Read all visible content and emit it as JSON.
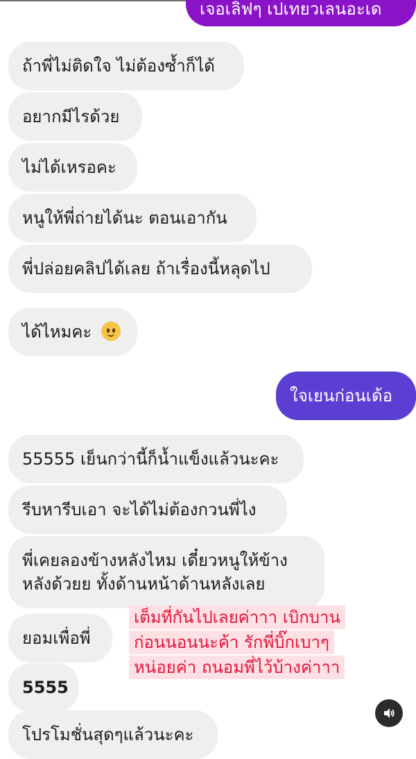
{
  "top_message": "เจอเลิฟๆ เปเทยวเลนอะเด",
  "messages": [
    {
      "text": "ถ้าพี่ไม่ติดใจ ไม่ต้องซ้ำก็ได้"
    },
    {
      "text": "อยากมีไรด้วย"
    },
    {
      "text": "ไม่ได้เหรอคะ"
    },
    {
      "text": "หนูให้พี่ถ่ายได้นะ ตอนเอากัน"
    },
    {
      "text": "พี่ปล่อยคลิปได้เลย ถ้าเรื่องนี้หลุดไป"
    },
    {
      "text": "ได้ไหมคะ"
    },
    {
      "text": "ใจเยนก่อนเด้อ"
    },
    {
      "text": "55555 เย็นกว่านี้ก็น้ำแข็งแล้วนะคะ"
    },
    {
      "text": "รีบหารีบเอา จะได้ไม่ต้องกวนพี่ไง"
    },
    {
      "line1": "พี่เคยลองข้างหลังไหม เดี๋ยวหนูให้ข้าง",
      "line2": "หลังด้วยย  ทั้งด้านหน้าด้านหลังเลย"
    },
    {
      "text": "ยอมเพื่อพี่"
    },
    {
      "text": "5555"
    },
    {
      "text": "โปรโมชั่นสุดๆแล้วนะคะ"
    }
  ],
  "overlay_caption": {
    "line1": "เต็มที่กันไปเลยค่าาา  เบิกบาน",
    "line2": "ก่อนนอนนะค้า  รักพี่บิ๊กเบาๆ",
    "line3": "หน่อยค่า  ถนอมพี่ไว้บ้างค่าาา"
  },
  "emoji_icon": "face-with-tear-emoji",
  "sound_icon": "speaker-icon",
  "colors": {
    "incoming_bubble": "#efefef",
    "outgoing_top_bubble": "#8a12c7",
    "outgoing_bubble": "#5b3fd3",
    "overlay_text": "#e2163a",
    "overlay_bg": "#fde0e4",
    "sound_button": "#2b2b2b"
  }
}
